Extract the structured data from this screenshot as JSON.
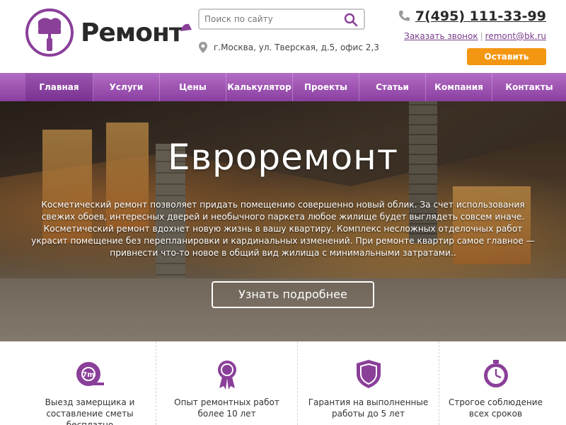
{
  "header": {
    "logo_text": "Ремонт",
    "search_placeholder": "Поиск по сайту",
    "address": "г.Москва, ул. Тверская, д.5, офис 2,3",
    "phone": "7(495) 111-33-99",
    "callback_link": "Заказать звонок",
    "email": "remont@bk.ru",
    "order_button": "Оставить заявку",
    "accent_color": "#8a3f99",
    "order_color": "#f39712"
  },
  "nav": {
    "items": [
      {
        "label": "Главная",
        "active": true
      },
      {
        "label": "Услуги"
      },
      {
        "label": "Цены"
      },
      {
        "label": "Калькулятор"
      },
      {
        "label": "Проекты"
      },
      {
        "label": "Статьи"
      },
      {
        "label": "Компания"
      },
      {
        "label": "Контакты"
      }
    ]
  },
  "hero": {
    "title": "Евроремонт",
    "paragraph1": "Косметический ремонт позволяет придать помещению совершенно новый облик. За счет использования свежих обоев, интересных дверей и необычного паркета любое жилище будет выглядеть совсем иначе.",
    "paragraph2": "Косметический ремонт вдохнет новую жизнь в вашу квартиру. Комплекс несложных отделочных работ украсит помещение без перепланировки и кардинальных изменений. При ремонте квартир самое главное — привнести что-то новое в общий вид жилища с минимальными затратами..",
    "button": "Узнать подробнее"
  },
  "features": [
    {
      "icon": "tape-measure-icon",
      "icon_label": "7m",
      "text": "Выезд замерщика и составление сметы бесплатно"
    },
    {
      "icon": "award-ribbon-icon",
      "text": "Опыт ремонтных работ более 10 лет"
    },
    {
      "icon": "shield-icon",
      "text": "Гарантия на выполненные работы до 5 лет"
    },
    {
      "icon": "clock-icon",
      "text": "Строгое соблюдение всех сроков"
    }
  ]
}
